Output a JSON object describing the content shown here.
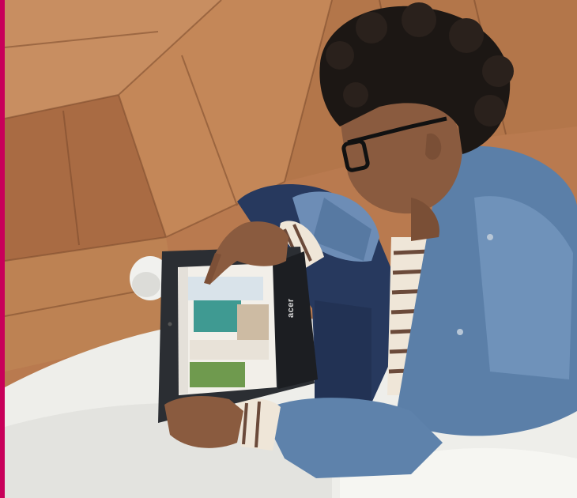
{
  "image": {
    "accent_color": "#c8005a",
    "floor_color": "#b97a4f",
    "couch_color": "#eeeeea",
    "jacket_color": "#5b7fa8",
    "tablet_color": "#2b2e33"
  },
  "tablet": {
    "brand": "acer"
  }
}
